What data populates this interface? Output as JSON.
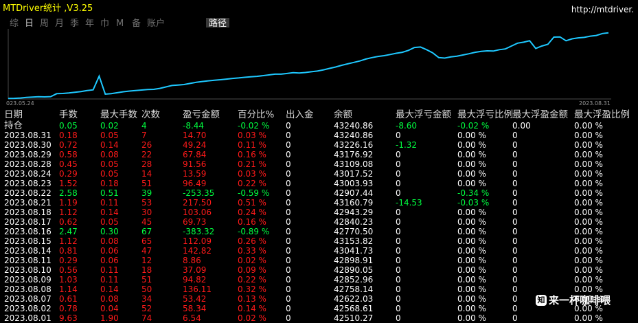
{
  "app": {
    "title": "MTDriver统计 ,V3.25",
    "url": "http://mtdriver."
  },
  "tabs": [
    {
      "label": "综",
      "active": false
    },
    {
      "label": "日",
      "active": true
    },
    {
      "label": "周",
      "active": false
    },
    {
      "label": "月",
      "active": false
    },
    {
      "label": "季",
      "active": false
    },
    {
      "label": "年",
      "active": false
    },
    {
      "label": "巾",
      "active": false
    },
    {
      "label": "M",
      "active": false
    },
    {
      "label": "备",
      "active": false
    },
    {
      "label": "账户",
      "active": false
    }
  ],
  "path_button": "路径",
  "chart_data": {
    "type": "line",
    "x_start_label": "023.05.24",
    "x_end_label": "2023.08.31",
    "color": "#1ec8ff",
    "x": [
      0,
      1,
      2,
      3,
      4,
      5,
      6,
      7,
      8,
      9,
      10,
      11,
      12,
      13,
      14,
      15,
      16,
      17,
      18,
      19,
      20,
      21,
      22,
      23,
      24,
      25,
      26,
      27,
      28,
      29,
      30,
      31,
      32,
      33,
      34,
      35,
      36,
      37,
      38,
      39,
      40,
      41,
      42,
      43,
      44,
      45,
      46,
      47,
      48,
      49,
      50,
      51,
      52,
      53,
      54,
      55,
      56,
      57,
      58,
      59,
      60,
      61,
      62,
      63,
      64,
      65,
      66,
      67,
      68,
      69,
      70,
      71,
      72,
      73,
      74,
      75,
      76,
      77,
      78,
      79,
      80,
      81,
      82,
      83,
      84,
      85,
      86,
      87,
      88,
      89,
      90,
      91,
      92,
      93,
      94,
      95,
      96,
      97,
      98,
      99
    ],
    "values": [
      40220,
      40225,
      40240,
      40262,
      40280,
      40290,
      40285,
      40298,
      40420,
      40430,
      40450,
      40480,
      40510,
      40550,
      40580,
      41150,
      40400,
      40420,
      40460,
      40500,
      40530,
      40548,
      40570,
      40590,
      40600,
      40640,
      40700,
      40760,
      40780,
      40800,
      40845,
      40890,
      40925,
      40955,
      40980,
      41000,
      41025,
      41055,
      41075,
      41100,
      41120,
      41140,
      41170,
      41200,
      41230,
      41230,
      41260,
      41290,
      41280,
      41300,
      41330,
      41360,
      41410,
      41470,
      41530,
      41600,
      41660,
      41720,
      41780,
      41860,
      41920,
      41970,
      42000,
      42050,
      42100,
      42140,
      42220,
      42340,
      42360,
      42250,
      42120,
      41920,
      41900,
      41950,
      41980,
      42030,
      42080,
      42140,
      42180,
      42200,
      42190,
      42250,
      42280,
      42400,
      42520,
      42560,
      42620,
      42300,
      42400,
      42470,
      42770,
      42780,
      42620,
      42700,
      42740,
      42760,
      42810,
      42840,
      42920,
      42950
    ]
  },
  "table": {
    "headers": [
      "日期",
      "手数",
      "最大手数",
      "次数",
      "盈亏金额",
      "百分比%",
      "出入金",
      "余额",
      "最大浮亏金额",
      "最大浮亏比例",
      "最大浮盈金额",
      "最大浮盈比例"
    ],
    "rows": [
      {
        "date": "持仓",
        "lots": "0.05",
        "max_lots": "0.02",
        "count": "4",
        "pnl": "-8.44",
        "pct": "-0.02 %",
        "io": "0",
        "bal": "43240.86",
        "mfl": "-8.60",
        "mflp": "-0.02 %",
        "mfp": "0.00",
        "mfpp": "0.00 %",
        "c": "g",
        "mflc": "g",
        "mflpc": "g"
      },
      {
        "date": "2023.08.31",
        "lots": "0.18",
        "max_lots": "0.05",
        "count": "7",
        "pnl": "14.70",
        "pct": "0.03 %",
        "io": "0",
        "bal": "43240.86",
        "mfl": "0",
        "mflp": "0.00 %",
        "mfp": "0",
        "mfpp": "0.00 %",
        "c": "r",
        "mflc": "w",
        "mflpc": "w"
      },
      {
        "date": "2023.08.30",
        "lots": "0.72",
        "max_lots": "0.14",
        "count": "26",
        "pnl": "49.24",
        "pct": "0.11 %",
        "io": "0",
        "bal": "43226.16",
        "mfl": "-1.32",
        "mflp": "0.00 %",
        "mfp": "0",
        "mfpp": "0.00 %",
        "c": "r",
        "mflc": "g",
        "mflpc": "w"
      },
      {
        "date": "2023.08.29",
        "lots": "0.58",
        "max_lots": "0.08",
        "count": "22",
        "pnl": "67.84",
        "pct": "0.16 %",
        "io": "0",
        "bal": "43176.92",
        "mfl": "0",
        "mflp": "0.00 %",
        "mfp": "0",
        "mfpp": "0.00 %",
        "c": "r",
        "mflc": "w",
        "mflpc": "w"
      },
      {
        "date": "2023.08.28",
        "lots": "0.45",
        "max_lots": "0.05",
        "count": "28",
        "pnl": "91.56",
        "pct": "0.21 %",
        "io": "0",
        "bal": "43109.08",
        "mfl": "0",
        "mflp": "0.00 %",
        "mfp": "0",
        "mfpp": "0.00 %",
        "c": "r",
        "mflc": "w",
        "mflpc": "w"
      },
      {
        "date": "2023.08.24",
        "lots": "0.29",
        "max_lots": "0.05",
        "count": "14",
        "pnl": "13.59",
        "pct": "0.03 %",
        "io": "0",
        "bal": "43017.52",
        "mfl": "0",
        "mflp": "0.00 %",
        "mfp": "0",
        "mfpp": "0.00 %",
        "c": "r",
        "mflc": "w",
        "mflpc": "w"
      },
      {
        "date": "2023.08.23",
        "lots": "1.52",
        "max_lots": "0.18",
        "count": "51",
        "pnl": "96.49",
        "pct": "0.22 %",
        "io": "0",
        "bal": "43003.93",
        "mfl": "0",
        "mflp": "0.00 %",
        "mfp": "0",
        "mfpp": "0.00 %",
        "c": "r",
        "mflc": "w",
        "mflpc": "w"
      },
      {
        "date": "2023.08.22",
        "lots": "2.58",
        "max_lots": "0.51",
        "count": "39",
        "pnl": "-253.35",
        "pct": "-0.59 %",
        "io": "0",
        "bal": "42907.44",
        "mfl": "0",
        "mflp": "-0.34 %",
        "mfp": "0",
        "mfpp": "0.00 %",
        "c": "g",
        "mflc": "w",
        "mflpc": "g"
      },
      {
        "date": "2023.08.21",
        "lots": "1.19",
        "max_lots": "0.11",
        "count": "53",
        "pnl": "217.50",
        "pct": "0.51 %",
        "io": "0",
        "bal": "43160.79",
        "mfl": "-14.53",
        "mflp": "-0.03 %",
        "mfp": "0",
        "mfpp": "0.00 %",
        "c": "r",
        "mflc": "g",
        "mflpc": "g"
      },
      {
        "date": "2023.08.18",
        "lots": "1.12",
        "max_lots": "0.14",
        "count": "30",
        "pnl": "103.06",
        "pct": "0.24 %",
        "io": "0",
        "bal": "42943.29",
        "mfl": "0",
        "mflp": "0.00 %",
        "mfp": "0",
        "mfpp": "0.00 %",
        "c": "r",
        "mflc": "w",
        "mflpc": "w"
      },
      {
        "date": "2023.08.17",
        "lots": "0.62",
        "max_lots": "0.05",
        "count": "45",
        "pnl": "69.73",
        "pct": "0.16 %",
        "io": "0",
        "bal": "42840.23",
        "mfl": "0",
        "mflp": "0.00 %",
        "mfp": "0",
        "mfpp": "0.00 %",
        "c": "r",
        "mflc": "w",
        "mflpc": "w"
      },
      {
        "date": "2023.08.16",
        "lots": "2.47",
        "max_lots": "0.30",
        "count": "67",
        "pnl": "-383.32",
        "pct": "-0.89 %",
        "io": "0",
        "bal": "42770.50",
        "mfl": "0",
        "mflp": "0.00 %",
        "mfp": "0",
        "mfpp": "0.00 %",
        "c": "g",
        "mflc": "w",
        "mflpc": "w"
      },
      {
        "date": "2023.08.15",
        "lots": "1.12",
        "max_lots": "0.08",
        "count": "65",
        "pnl": "112.09",
        "pct": "0.26 %",
        "io": "0",
        "bal": "43153.82",
        "mfl": "0",
        "mflp": "0.00 %",
        "mfp": "0",
        "mfpp": "0.00 %",
        "c": "r",
        "mflc": "w",
        "mflpc": "w"
      },
      {
        "date": "2023.08.14",
        "lots": "0.81",
        "max_lots": "0.06",
        "count": "47",
        "pnl": "142.82",
        "pct": "0.33 %",
        "io": "0",
        "bal": "43041.73",
        "mfl": "0",
        "mflp": "0.00 %",
        "mfp": "0",
        "mfpp": "0.00 %",
        "c": "r",
        "mflc": "w",
        "mflpc": "w"
      },
      {
        "date": "2023.08.11",
        "lots": "0.29",
        "max_lots": "0.06",
        "count": "12",
        "pnl": "8.86",
        "pct": "0.02 %",
        "io": "0",
        "bal": "42898.91",
        "mfl": "0",
        "mflp": "0.00 %",
        "mfp": "0",
        "mfpp": "0.00 %",
        "c": "r",
        "mflc": "w",
        "mflpc": "w"
      },
      {
        "date": "2023.08.10",
        "lots": "0.56",
        "max_lots": "0.11",
        "count": "18",
        "pnl": "37.09",
        "pct": "0.09 %",
        "io": "0",
        "bal": "42890.05",
        "mfl": "0",
        "mflp": "0.00 %",
        "mfp": "0",
        "mfpp": "0.00 %",
        "c": "r",
        "mflc": "w",
        "mflpc": "w"
      },
      {
        "date": "2023.08.09",
        "lots": "1.03",
        "max_lots": "0.11",
        "count": "51",
        "pnl": "94.82",
        "pct": "0.22 %",
        "io": "0",
        "bal": "42852.96",
        "mfl": "0",
        "mflp": "0.00 %",
        "mfp": "0",
        "mfpp": "0.00 %",
        "c": "r",
        "mflc": "w",
        "mflpc": "w"
      },
      {
        "date": "2023.08.08",
        "lots": "1.14",
        "max_lots": "0.14",
        "count": "50",
        "pnl": "136.11",
        "pct": "0.32 %",
        "io": "0",
        "bal": "42758.14",
        "mfl": "0",
        "mflp": "0.00 %",
        "mfp": "0",
        "mfpp": "0.00 %",
        "c": "r",
        "mflc": "w",
        "mflpc": "w"
      },
      {
        "date": "2023.08.07",
        "lots": "0.61",
        "max_lots": "0.08",
        "count": "34",
        "pnl": "53.42",
        "pct": "0.13 %",
        "io": "0",
        "bal": "42622.03",
        "mfl": "0",
        "mflp": "0.00 %",
        "mfp": "0",
        "mfpp": "0.00 %",
        "c": "r",
        "mflc": "w",
        "mflpc": "w"
      },
      {
        "date": "2023.08.02",
        "lots": "0.78",
        "max_lots": "0.04",
        "count": "52",
        "pnl": "58.34",
        "pct": "0.14 %",
        "io": "0",
        "bal": "42568.61",
        "mfl": "0",
        "mflp": "0.00 %",
        "mfp": "0",
        "mfpp": "0.00 %",
        "c": "r",
        "mflc": "w",
        "mflpc": "w"
      },
      {
        "date": "2023.08.01",
        "lots": "9.63",
        "max_lots": "1.90",
        "count": "74",
        "pnl": "6.54",
        "pct": "0.02 %",
        "io": "0",
        "bal": "42510.27",
        "mfl": "0",
        "mflp": "0.00 %",
        "mfp": "0",
        "mfpp": "0.00 %",
        "c": "r",
        "mflc": "w",
        "mflpc": "w"
      }
    ]
  },
  "watermark": {
    "icon": "zhihu-icon",
    "text": "来一杯咖啡喂"
  },
  "colors": {
    "title": "#ffff00",
    "line": "#1ec8ff",
    "positive": "#ff1a1a",
    "negative": "#00ff40",
    "neutral": "#ffffff",
    "header": "#d8d8d8"
  }
}
